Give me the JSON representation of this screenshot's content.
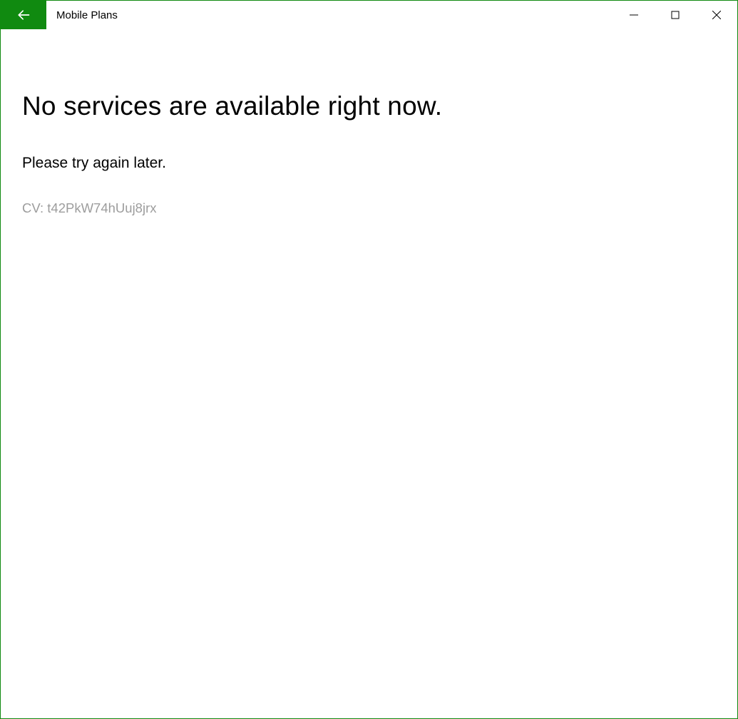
{
  "titlebar": {
    "title": "Mobile Plans"
  },
  "content": {
    "heading": "No services are available right now.",
    "subtext": "Please try again later.",
    "cv": "CV: t42PkW74hUuj8jrx"
  },
  "colors": {
    "accent": "#108a10"
  }
}
